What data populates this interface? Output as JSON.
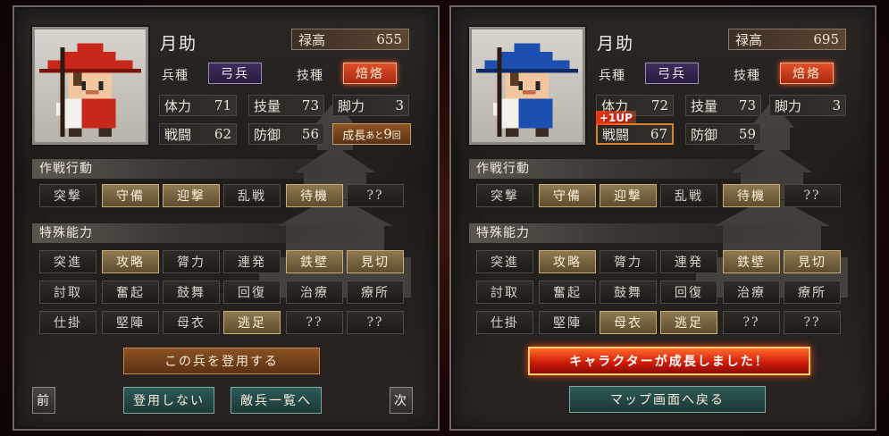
{
  "left": {
    "name": "月助",
    "stipend_label": "禄高",
    "stipend_value": "655",
    "unit_label": "兵種",
    "unit_value": "弓兵",
    "skill_label": "技種",
    "skill_value": "焙烙",
    "stats": {
      "hp_label": "体力",
      "hp": "71",
      "tech_label": "技量",
      "tech": "73",
      "leg_label": "脚力",
      "leg": "3",
      "atk_label": "戦闘",
      "atk": "62",
      "def_label": "防御",
      "def": "56"
    },
    "growth": {
      "text": "成長",
      "small1": "あと",
      "num": "9",
      "small2": "回"
    },
    "tactics_title": "作戦行動",
    "tactics": [
      "突撃",
      "守備",
      "迎撃",
      "乱戦",
      "待機",
      "??"
    ],
    "abilities_title": "特殊能力",
    "abilities": [
      "突進",
      "攻略",
      "膂力",
      "連発",
      "鉄壁",
      "見切",
      "討取",
      "奮起",
      "鼓舞",
      "回復",
      "治療",
      "療所",
      "仕掛",
      "堅陣",
      "母衣",
      "逃足",
      "??",
      "??"
    ],
    "recruit_button": "この兵を登用する",
    "prev_button": "前",
    "decline_button": "登用しない",
    "list_button": "敵兵一覧へ",
    "next_button": "次"
  },
  "right": {
    "name": "月助",
    "stipend_label": "禄高",
    "stipend_value": "695",
    "unit_label": "兵種",
    "unit_value": "弓兵",
    "skill_label": "技種",
    "skill_value": "焙烙",
    "stats": {
      "hp_label": "体力",
      "hp": "72",
      "tech_label": "技量",
      "tech": "73",
      "leg_label": "脚力",
      "leg": "3",
      "atk_label": "戦闘",
      "atk": "67",
      "def_label": "防御",
      "def": "59"
    },
    "up_badge": "+1UP",
    "tactics_title": "作戦行動",
    "tactics": [
      "突撃",
      "守備",
      "迎撃",
      "乱戦",
      "待機",
      "??"
    ],
    "abilities_title": "特殊能力",
    "abilities": [
      "突進",
      "攻略",
      "膂力",
      "連発",
      "鉄壁",
      "見切",
      "討取",
      "奮起",
      "鼓舞",
      "回復",
      "治療",
      "療所",
      "仕掛",
      "堅陣",
      "母衣",
      "逃足",
      "??",
      "??"
    ],
    "growth_banner": "キャラクターが成長しました！",
    "return_button": "マップ画面へ戻る"
  },
  "colors": {
    "left_hat": "#c8281c",
    "right_hat": "#1d4fb0"
  }
}
